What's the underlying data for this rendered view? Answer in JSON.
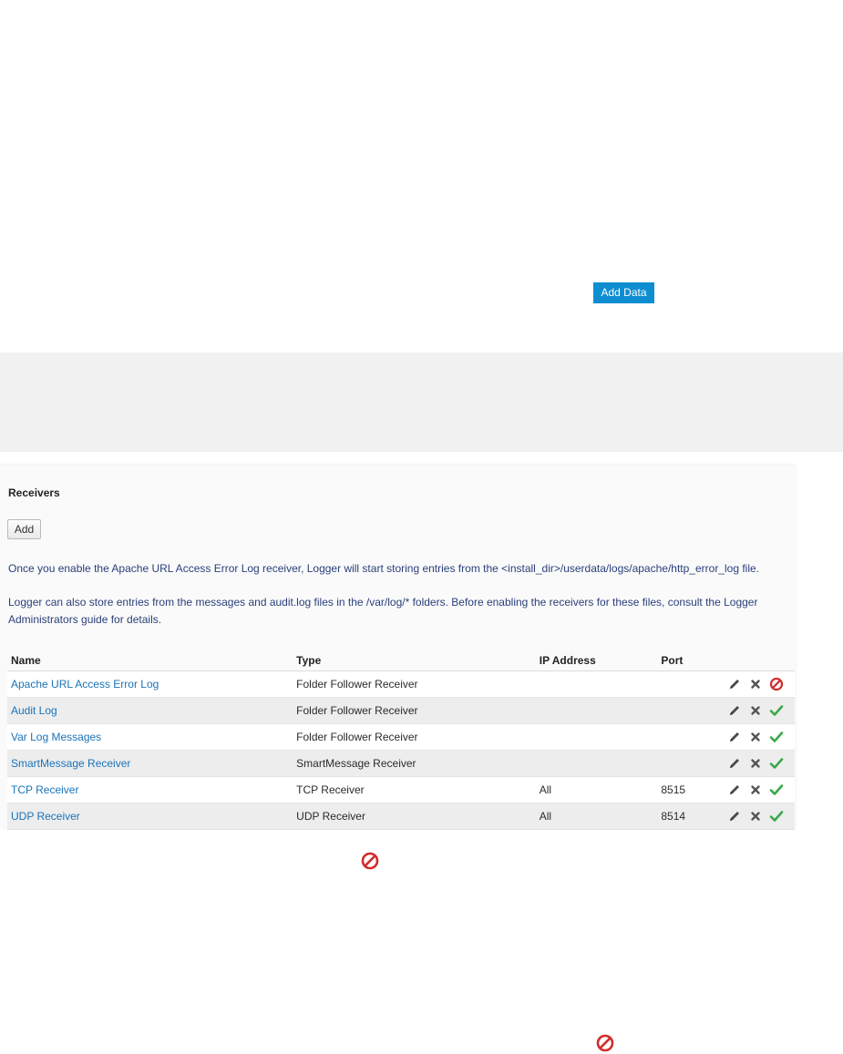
{
  "toolbar": {
    "add_data_label": "Add Data"
  },
  "receivers": {
    "title": "Receivers",
    "add_label": "Add",
    "info_1": "Once you enable the Apache URL Access Error Log receiver, Logger will start storing entries from the <install_dir>/userdata/logs/apache/http_error_log file.",
    "info_2": "Logger can also store entries from the messages and audit.log files in the /var/log/* folders. Before enabling the receivers for these files, consult the Logger Administrators guide for details.",
    "columns": {
      "name": "Name",
      "type": "Type",
      "ip": "IP Address",
      "port": "Port"
    },
    "rows": [
      {
        "name": "Apache URL Access Error Log",
        "type": "Folder Follower Receiver",
        "ip": "",
        "port": "",
        "status": "disabled"
      },
      {
        "name": "Audit Log",
        "type": "Folder Follower Receiver",
        "ip": "",
        "port": "",
        "status": "enabled"
      },
      {
        "name": "Var Log Messages",
        "type": "Folder Follower Receiver",
        "ip": "",
        "port": "",
        "status": "enabled"
      },
      {
        "name": "SmartMessage Receiver",
        "type": "SmartMessage Receiver",
        "ip": "",
        "port": "",
        "status": "enabled"
      },
      {
        "name": "TCP Receiver",
        "type": "TCP Receiver",
        "ip": "All",
        "port": "8515",
        "status": "enabled"
      },
      {
        "name": "UDP Receiver",
        "type": "UDP Receiver",
        "ip": "All",
        "port": "8514",
        "status": "enabled"
      }
    ]
  },
  "icons": {
    "edit": "pencil-icon",
    "delete": "delete-x-icon",
    "enabled": "checkmark-icon",
    "disabled": "disabled-icon"
  },
  "colors": {
    "accent": "#0e8ed1",
    "link": "#1a73b8",
    "info_text": "#2a3f7a",
    "enabled_green": "#3aa84a",
    "disabled_red": "#d22c2c"
  }
}
